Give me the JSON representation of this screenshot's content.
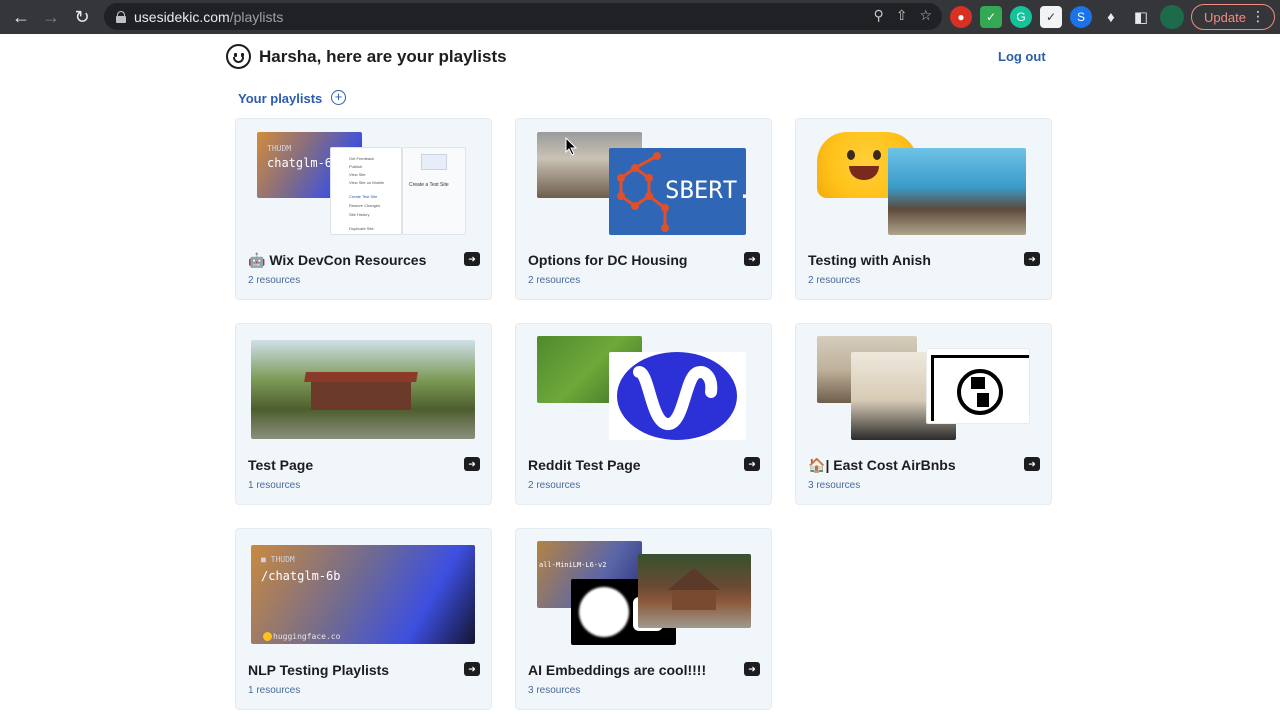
{
  "browser": {
    "url_host": "usesidekic.com",
    "url_path": "/playlists",
    "update_label": "Update",
    "colors": {
      "frame": "#35363a",
      "omnibox": "#202124",
      "update": "#f28b82"
    }
  },
  "header": {
    "title": "Harsha, here are your playlists",
    "logout_label": "Log out"
  },
  "section": {
    "title": "Your playlists"
  },
  "playlists": [
    {
      "title": "Wix DevCon Resources",
      "emoji": "🤖",
      "count": "2 resources"
    },
    {
      "title": "Options for DC Housing",
      "emoji": "",
      "count": "2 resources"
    },
    {
      "title": "Testing with Anish",
      "emoji": "",
      "count": "2 resources"
    },
    {
      "title": "Test Page",
      "emoji": "",
      "count": "1 resources"
    },
    {
      "title": "Reddit Test Page",
      "emoji": "",
      "count": "2 resources"
    },
    {
      "title": "| East Cost AirBnbs",
      "emoji": "🏠",
      "count": "3 resources"
    },
    {
      "title": "NLP Testing Playlists",
      "emoji": "",
      "count": "1 resources"
    },
    {
      "title": "AI Embeddings are cool!!!!",
      "emoji": "",
      "count": "3 resources"
    }
  ],
  "thumbnails": {
    "hf_small": "THUDM",
    "hf_code_1": "chatglm-6b",
    "hf_footer": "huggingface.co",
    "hf_code_2": "/chatglm-6b",
    "sbert_brand": "SBERT.ne",
    "minilm_code": "all-MiniLM-L6-v2",
    "menu_items": [
      "Get Feedback",
      "Publish",
      "View Site",
      "View Site on Mobile",
      "Create Test Site",
      "Restore Changes",
      "Site History",
      "Duplicate Site"
    ],
    "panel_title": "Create a Test Site"
  },
  "colors": {
    "accent": "#2b5cad",
    "card_bg": "#f1f6fb",
    "text": "#1d1d1f"
  }
}
